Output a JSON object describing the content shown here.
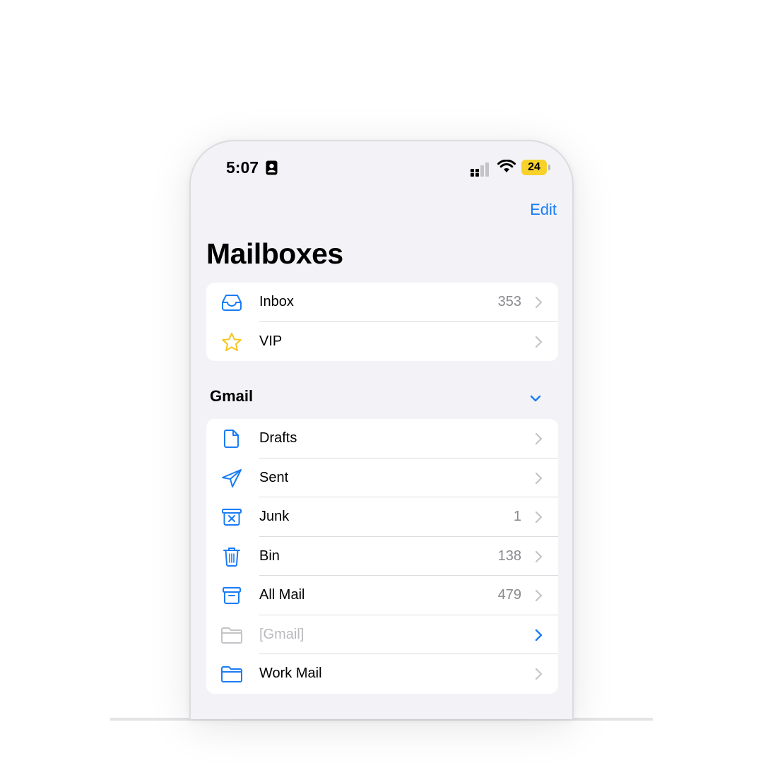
{
  "status_bar": {
    "time": "5:07",
    "battery_level": "24",
    "icons": [
      "contact-card-icon",
      "cellular-signal-icon",
      "wifi-icon",
      "battery-icon"
    ]
  },
  "nav": {
    "edit_label": "Edit",
    "title": "Mailboxes"
  },
  "mailboxes": [
    {
      "label": "Inbox",
      "count": "353",
      "icon": "inbox-tray-icon"
    },
    {
      "label": "VIP",
      "count": "",
      "icon": "star-icon"
    }
  ],
  "account": {
    "name": "Gmail",
    "expanded": true,
    "folders": [
      {
        "label": "Drafts",
        "count": "",
        "icon": "document-icon"
      },
      {
        "label": "Sent",
        "count": "",
        "icon": "paper-plane-icon"
      },
      {
        "label": "Junk",
        "count": "1",
        "icon": "junk-bin-icon"
      },
      {
        "label": "Bin",
        "count": "138",
        "icon": "trash-icon"
      },
      {
        "label": "All Mail",
        "count": "479",
        "icon": "archive-box-icon"
      },
      {
        "label": "[Gmail]",
        "count": "",
        "icon": "folder-icon",
        "disabled": true
      },
      {
        "label": "Work Mail",
        "count": "",
        "icon": "folder-icon"
      }
    ]
  },
  "colors": {
    "accent": "#1a7cf5",
    "star": "#f4c51d",
    "background": "#f2f2f7",
    "secondary_text": "#8a8a8f",
    "disabled_text": "#b9b9be"
  }
}
